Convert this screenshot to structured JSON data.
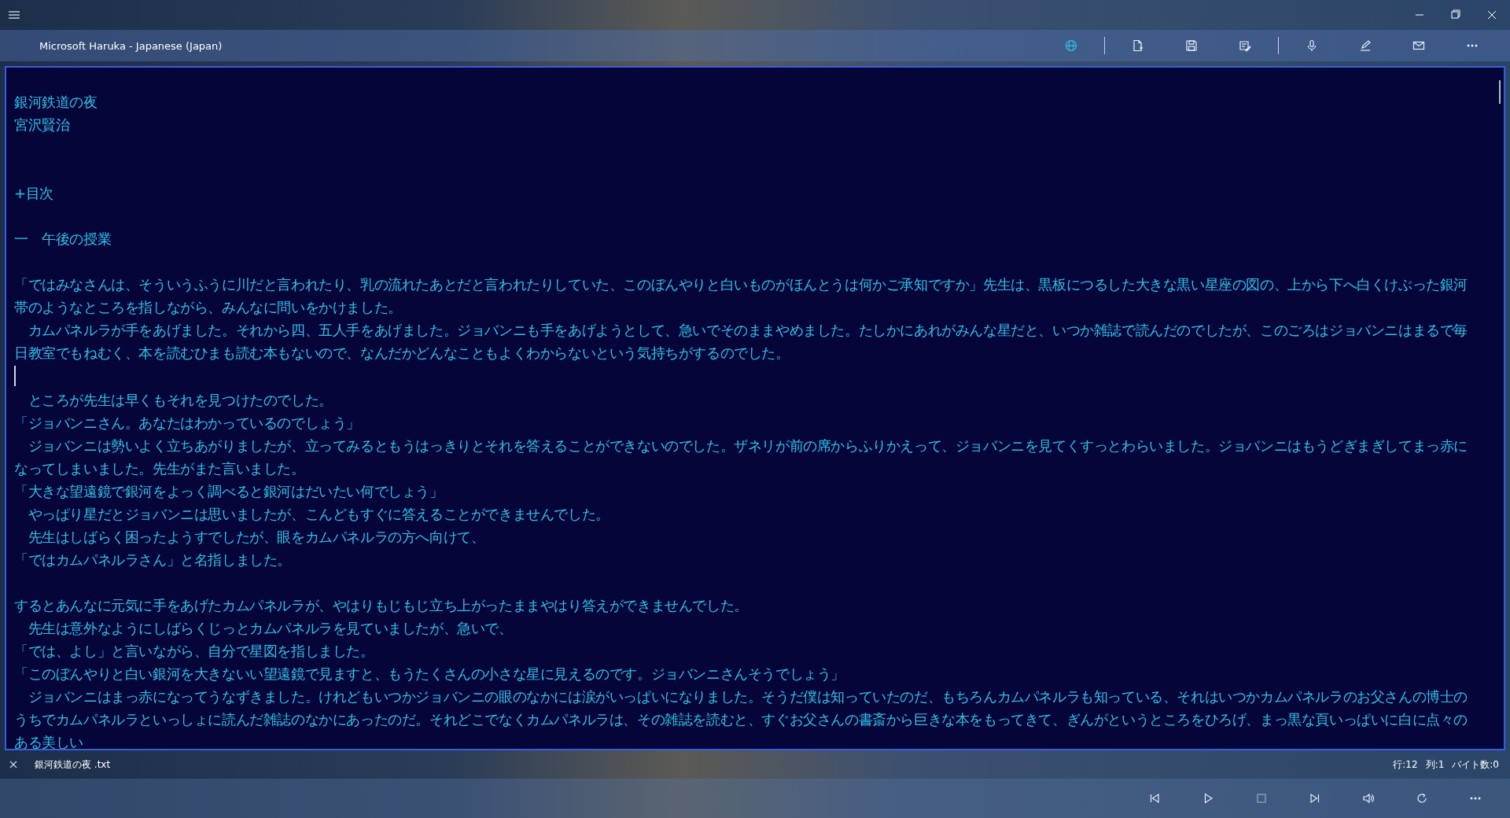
{
  "voice": "Microsoft Haruka - Japanese (Japan)",
  "toolbar": [
    {
      "kind": "globe",
      "active": true
    },
    {
      "kind": "separator"
    },
    {
      "kind": "new-file",
      "active": false
    },
    {
      "kind": "save",
      "active": false
    },
    {
      "kind": "edit-file",
      "active": false
    },
    {
      "kind": "separator"
    },
    {
      "kind": "mic",
      "active": false
    },
    {
      "kind": "pen",
      "active": false
    },
    {
      "kind": "mail",
      "active": false
    },
    {
      "kind": "more",
      "active": false
    }
  ],
  "document": {
    "lines": [
      {
        "kind": "blank"
      },
      {
        "kind": "text",
        "text": "銀河鉄道の夜"
      },
      {
        "kind": "text",
        "text": "宮沢賢治"
      },
      {
        "kind": "blank"
      },
      {
        "kind": "blank"
      },
      {
        "kind": "text",
        "text": "+目次"
      },
      {
        "kind": "blank"
      },
      {
        "kind": "text",
        "text": "一　午後の授業"
      },
      {
        "kind": "blank"
      },
      {
        "kind": "text",
        "text": "「ではみなさんは、そういうふうに川だと言われたり、乳の流れたあとだと言われたりしていた、このぼんやりと白いものがほんとうは何かご承知ですか」先生は、黒板につるした大きな黒い星座の図の、上から下へ白くけぶった銀河帯のようなところを指しながら、みんなに問いをかけました。"
      },
      {
        "kind": "text",
        "text": "　カムパネルラが手をあげました。それから四、五人手をあげました。ジョバンニも手をあげようとして、急いでそのままやめました。たしかにあれがみんな星だと、いつか雑誌で読んだのでしたが、このごろはジョバンニはまるで毎日教室でもねむく、本を読むひまも読む本もないので、なんだかどんなこともよくわからないという気持ちがするのでした。"
      },
      {
        "kind": "caret"
      },
      {
        "kind": "text",
        "text": "　ところが先生は早くもそれを見つけたのでした。"
      },
      {
        "kind": "text",
        "text": "「ジョバンニさん。あなたはわかっているのでしょう」"
      },
      {
        "kind": "text",
        "text": "　ジョバンニは勢いよく立ちあがりましたが、立ってみるともうはっきりとそれを答えることができないのでした。ザネリが前の席からふりかえって、ジョバンニを見てくすっとわらいました。ジョバンニはもうどぎまぎしてまっ赤になってしまいました。先生がまた言いました。"
      },
      {
        "kind": "text",
        "text": "「大きな望遠鏡で銀河をよっく調べると銀河はだいたい何でしょう」"
      },
      {
        "kind": "text",
        "text": "　やっぱり星だとジョバンニは思いましたが、こんどもすぐに答えることができませんでした。"
      },
      {
        "kind": "text",
        "text": "　先生はしばらく困ったようすでしたが、眼をカムパネルラの方へ向けて、"
      },
      {
        "kind": "text",
        "text": "「ではカムパネルラさん」と名指しました。"
      },
      {
        "kind": "blank"
      },
      {
        "kind": "text",
        "text": "するとあんなに元気に手をあげたカムパネルラが、やはりもじもじ立ち上がったままやはり答えができませんでした。"
      },
      {
        "kind": "text",
        "text": "　先生は意外なようにしばらくじっとカムパネルラを見ていましたが、急いで、"
      },
      {
        "kind": "text",
        "text": "「では、よし」と言いながら、自分で星図を指しました。"
      },
      {
        "kind": "text",
        "text": "「このぼんやりと白い銀河を大きないい望遠鏡で見ますと、もうたくさんの小さな星に見えるのです。ジョバンニさんそうでしょう」"
      },
      {
        "kind": "text",
        "text": "　ジョバンニはまっ赤になってうなずきました。けれどもいつかジョバンニの眼のなかには涙がいっぱいになりました。そうだ僕は知っていたのだ、もちろんカムパネルラも知っている、それはいつかカムパネルラのお父さんの博士のうちでカムパネルラといっしょに読んだ雑誌のなかにあったのだ。それどこでなくカムパネルラは、その雑誌を読むと、すぐお父さんの書斎から巨きな本をもってきて、ぎんがというところをひろげ、まっ黒な頁いっぱいに白に点々のある美しい"
      }
    ]
  },
  "status": {
    "file": "銀河鉄道の夜 .txt",
    "line": "行:12",
    "column": "列:1",
    "bytes": "バイト数:0"
  },
  "player": [
    {
      "kind": "previous"
    },
    {
      "kind": "play"
    },
    {
      "kind": "stop"
    },
    {
      "kind": "next"
    },
    {
      "kind": "volume"
    },
    {
      "kind": "repeat"
    },
    {
      "kind": "more"
    }
  ]
}
